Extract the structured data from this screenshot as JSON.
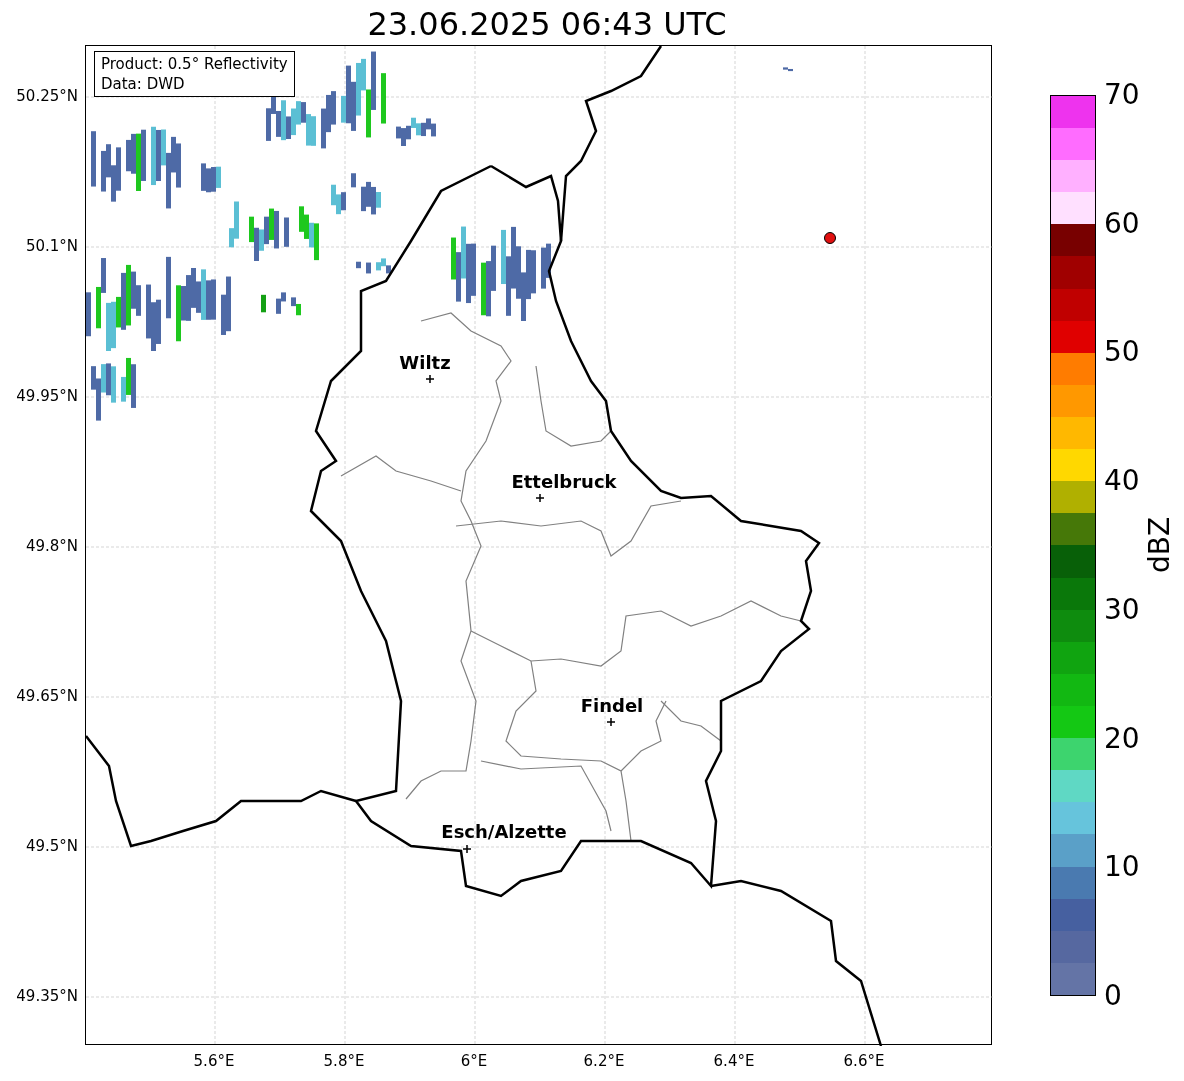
{
  "title": "23.06.2025 06:43 UTC",
  "info_box": {
    "lines": [
      "Product: 0.5° Reflectivity",
      "Data: DWD"
    ]
  },
  "map": {
    "yticks": [
      "50.25°N",
      "50.1°N",
      "49.95°N",
      "49.8°N",
      "49.65°N",
      "49.5°N",
      "49.35°N"
    ],
    "xticks": [
      "5.6°E",
      "5.8°E",
      "6°E",
      "6.2°E",
      "6.4°E",
      "6.6°E"
    ],
    "cities": [
      {
        "name": "Wiltz"
      },
      {
        "name": "Ettelbruck"
      },
      {
        "name": "Findel"
      },
      {
        "name": "Esch/Alzette"
      }
    ]
  },
  "colorbar": {
    "label": "dBZ",
    "ticks": [
      "70",
      "60",
      "50",
      "40",
      "30",
      "20",
      "10",
      "0"
    ],
    "bins": [
      {
        "color": "#6474a6"
      },
      {
        "color": "#5668a0"
      },
      {
        "color": "#4660a0"
      },
      {
        "color": "#4a7ab0"
      },
      {
        "color": "#5aa0c8"
      },
      {
        "color": "#66c4dc"
      },
      {
        "color": "#5fd8c4"
      },
      {
        "color": "#3dd46e"
      },
      {
        "color": "#14c814"
      },
      {
        "color": "#12b812"
      },
      {
        "color": "#10a410"
      },
      {
        "color": "#0e8c0e"
      },
      {
        "color": "#0a780a"
      },
      {
        "color": "#086008"
      },
      {
        "color": "#467808"
      },
      {
        "color": "#b0b000"
      },
      {
        "color": "#ffd800"
      },
      {
        "color": "#ffb800"
      },
      {
        "color": "#ff9800"
      },
      {
        "color": "#ff7c00"
      },
      {
        "color": "#e00000"
      },
      {
        "color": "#c00000"
      },
      {
        "color": "#a00000"
      },
      {
        "color": "#780000"
      },
      {
        "color": "#ffe0ff"
      },
      {
        "color": "#ffb0ff"
      },
      {
        "color": "#ff6cff"
      },
      {
        "color": "#ee33ee"
      }
    ]
  }
}
